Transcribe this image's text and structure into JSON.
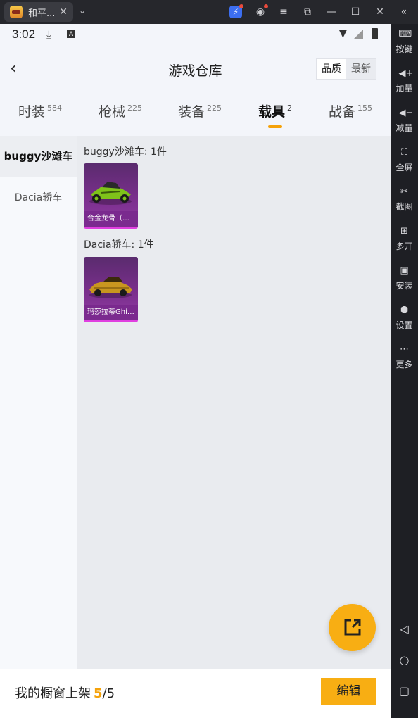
{
  "window": {
    "tab_title": "和平...",
    "close_glyph": "✕",
    "dropdown_glyph": "⌄",
    "controls": [
      "bolt-icon",
      "account-icon",
      "menu-icon",
      "popout-icon",
      "minimize-icon",
      "maximize-icon",
      "close-icon",
      "collapse-icon"
    ]
  },
  "side_toolbar": {
    "items": [
      {
        "icon": "keyboard-icon",
        "label": "按键"
      },
      {
        "icon": "volume-up-icon",
        "label": "加量"
      },
      {
        "icon": "volume-down-icon",
        "label": "减量"
      },
      {
        "icon": "fullscreen-icon",
        "label": "全屏"
      },
      {
        "icon": "scissors-icon",
        "label": "截图"
      },
      {
        "icon": "multi-instance-icon",
        "label": "多开"
      },
      {
        "icon": "apk-install-icon",
        "label": "安装"
      },
      {
        "icon": "settings-icon",
        "label": "设置"
      },
      {
        "icon": "more-icon",
        "label": "更多"
      }
    ],
    "nav": [
      "back-triangle-icon",
      "home-circle-icon",
      "recents-square-icon"
    ]
  },
  "status_bar": {
    "time": "3:02",
    "a_badge": "A"
  },
  "header": {
    "title": "游戏仓库",
    "sort_options": [
      {
        "label": "品质",
        "active": true
      },
      {
        "label": "最新",
        "active": false
      }
    ]
  },
  "categories": [
    {
      "label": "时装",
      "count": "584",
      "active": false
    },
    {
      "label": "枪械",
      "count": "225",
      "active": false
    },
    {
      "label": "装备",
      "count": "225",
      "active": false
    },
    {
      "label": "载具",
      "count": "2",
      "active": true
    },
    {
      "label": "战备",
      "count": "155",
      "active": false
    }
  ],
  "subcategories": [
    {
      "label": "buggy沙滩车",
      "active": true
    },
    {
      "label": "Dacia轿车",
      "active": false
    }
  ],
  "groups": [
    {
      "title": "buggy沙滩车: 1件",
      "items": [
        {
          "name": "合金龙骨（绿...",
          "car_color": "#7fc21a"
        }
      ]
    },
    {
      "title": "Dacia轿车: 1件",
      "items": [
        {
          "name": "玛莎拉蒂Ghib...",
          "car_color": "#c9961f"
        }
      ]
    }
  ],
  "bottom_bar": {
    "label": "我的橱窗上架",
    "count": "5",
    "total": "/5",
    "edit_label": "编辑"
  },
  "colors": {
    "accent": "#f8ae13",
    "card_purple": "#7a2f8c",
    "card_border": "#e03fe0"
  }
}
